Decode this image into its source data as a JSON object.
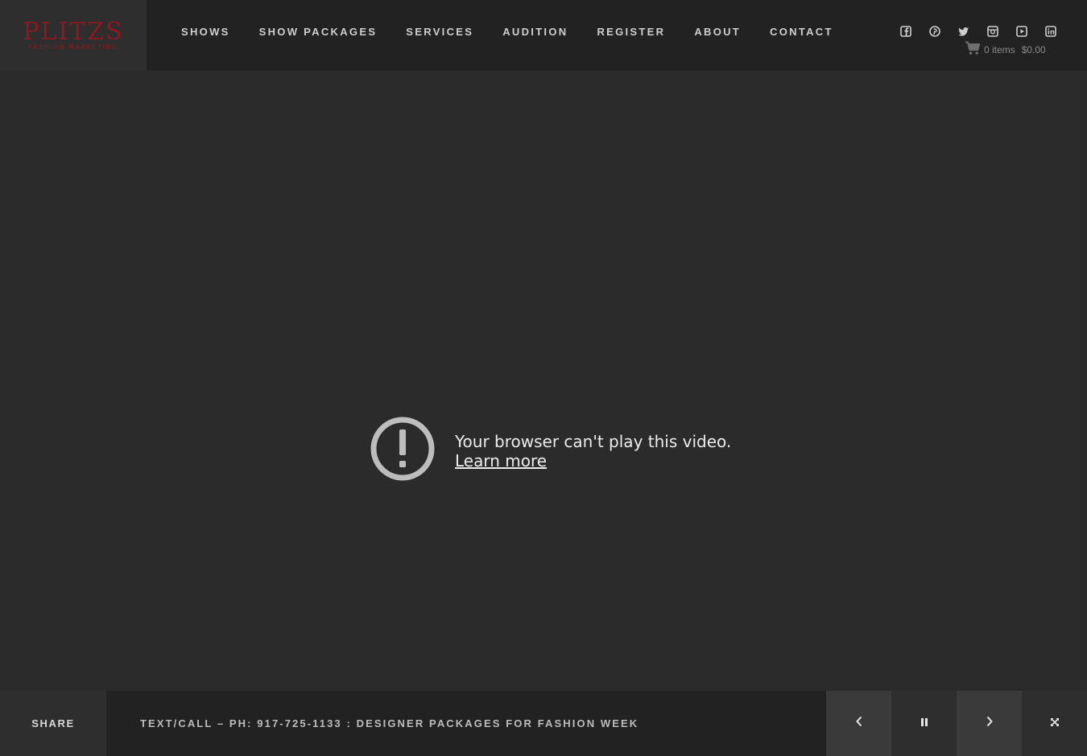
{
  "brand": {
    "logo_main": "PLITZS",
    "logo_sub": "FASHION MARKETING",
    "logo_color": "#8a1a1f"
  },
  "nav": {
    "items": [
      {
        "label": "SHOWS"
      },
      {
        "label": "SHOW PACKAGES"
      },
      {
        "label": "SERVICES"
      },
      {
        "label": "AUDITION"
      },
      {
        "label": "REGISTER"
      },
      {
        "label": "ABOUT"
      },
      {
        "label": "CONTACT"
      }
    ]
  },
  "social": {
    "icons": [
      "facebook-icon",
      "pinterest-icon",
      "twitter-icon",
      "instagram-icon",
      "youtube-icon",
      "linkedin-icon"
    ]
  },
  "cart": {
    "icon": "cart-icon",
    "items": "0 items",
    "total": "$0.00"
  },
  "video": {
    "error_icon": "alert-circle-icon",
    "error_message": "Your browser can't play this video.",
    "learn_more": "Learn more"
  },
  "footer": {
    "share_label": "SHARE",
    "ticker_text": "TEXT/CALL – PH: 917-725-1133  : DESIGNER PACKAGES FOR FASHION WEEK",
    "controls": [
      "chevron-left-icon",
      "pause-icon",
      "chevron-right-icon",
      "fullscreen-icon"
    ]
  },
  "colors": {
    "background": "#2b2b2b",
    "header_bg": "#222222",
    "text": "#d8d8d8"
  }
}
